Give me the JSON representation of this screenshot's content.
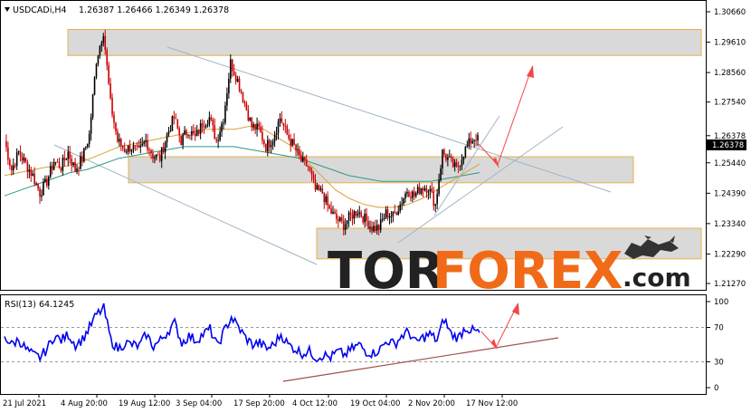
{
  "header": {
    "symbol": "USDCADi,H4",
    "ohlc": "1.26387 1.26466 1.26349 1.26378"
  },
  "rsi_label": "RSI(13) 64.1245",
  "current_price_label": "1.26378",
  "watermark": {
    "part1": "TOR",
    "part2": "FOREX",
    "part3": ".com"
  },
  "colors": {
    "candle_up": "#000000",
    "candle_down": "#cc0000",
    "ma_fast": "#d9a23a",
    "ma_slow": "#2e9a80",
    "rsi_line": "#0000ee",
    "zone_fill": "#d9d9d9",
    "zone_border": "#e8b04a",
    "arrow": "#f04848",
    "channel": "#a0b4c4",
    "rsi_trend": "#a05050",
    "price_label_bg": "#000000",
    "watermark_dark": "#222222",
    "watermark_orange": "#f06a18"
  },
  "chart_data": {
    "type": "candlestick",
    "y_ticks": [
      "1.30660",
      "1.29610",
      "1.28560",
      "1.27540",
      "1.26378",
      "1.25440",
      "1.24390",
      "1.23340",
      "1.22290",
      "1.21270"
    ],
    "ylim": [
      1.2127,
      1.3066
    ],
    "x_ticks": [
      "21 Jul 2021",
      "4 Aug 20:00",
      "19 Aug 12:00",
      "3 Sep 04:00",
      "17 Sep 20:00",
      "4 Oct 12:00",
      "19 Oct 04:00",
      "2 Nov 20:00",
      "17 Nov 12:00"
    ],
    "price_series": [
      1.262,
      1.252,
      1.258,
      1.254,
      1.25,
      1.244,
      1.248,
      1.255,
      1.253,
      1.258,
      1.252,
      1.256,
      1.264,
      1.29,
      1.3,
      1.275,
      1.262,
      1.259,
      1.26,
      1.258,
      1.262,
      1.257,
      1.256,
      1.264,
      1.27,
      1.262,
      1.266,
      1.263,
      1.268,
      1.27,
      1.262,
      1.27,
      1.289,
      1.283,
      1.275,
      1.267,
      1.266,
      1.26,
      1.263,
      1.27,
      1.264,
      1.26,
      1.255,
      1.253,
      1.245,
      1.244,
      1.238,
      1.235,
      1.233,
      1.236,
      1.238,
      1.235,
      1.232,
      1.232,
      1.237,
      1.236,
      1.24,
      1.245,
      1.243,
      1.246,
      1.246,
      1.24,
      1.258,
      1.255,
      1.252,
      1.258,
      1.262,
      1.264
    ],
    "ma_fast": [
      1.25,
      1.251,
      1.252,
      1.253,
      1.253,
      1.254,
      1.256,
      1.258,
      1.26,
      1.261,
      1.262,
      1.263,
      1.264,
      1.265,
      1.266,
      1.266,
      1.266,
      1.267,
      1.266,
      1.263,
      1.26,
      1.255,
      1.25,
      1.245,
      1.242,
      1.24,
      1.239,
      1.239,
      1.24,
      1.242,
      1.245,
      1.248,
      1.251,
      1.254
    ],
    "ma_slow": [
      1.243,
      1.245,
      1.247,
      1.249,
      1.251,
      1.252,
      1.254,
      1.256,
      1.257,
      1.258,
      1.259,
      1.26,
      1.26,
      1.26,
      1.26,
      1.259,
      1.258,
      1.257,
      1.256,
      1.254,
      1.252,
      1.25,
      1.249,
      1.248,
      1.248,
      1.248,
      1.248,
      1.249,
      1.25,
      1.251
    ],
    "zones": [
      {
        "from": 1.2915,
        "to": 1.3005
      },
      {
        "from": 1.2475,
        "to": 1.2565
      },
      {
        "from": 1.2212,
        "to": 1.2318
      }
    ],
    "rsi": {
      "ylim": [
        0,
        100
      ],
      "ticks": [
        "100",
        "70",
        "30",
        "0"
      ],
      "levels": [
        70,
        30
      ],
      "values": [
        60,
        50,
        56,
        45,
        38,
        35,
        45,
        60,
        55,
        62,
        50,
        56,
        70,
        85,
        92,
        55,
        45,
        52,
        50,
        48,
        62,
        48,
        55,
        65,
        75,
        52,
        60,
        55,
        62,
        68,
        48,
        66,
        82,
        70,
        58,
        50,
        52,
        45,
        50,
        62,
        50,
        45,
        40,
        42,
        35,
        38,
        35,
        42,
        38,
        45,
        50,
        42,
        40,
        45,
        55,
        50,
        60,
        65,
        52,
        58,
        62,
        55,
        80,
        62,
        58,
        70,
        66,
        64
      ]
    }
  }
}
